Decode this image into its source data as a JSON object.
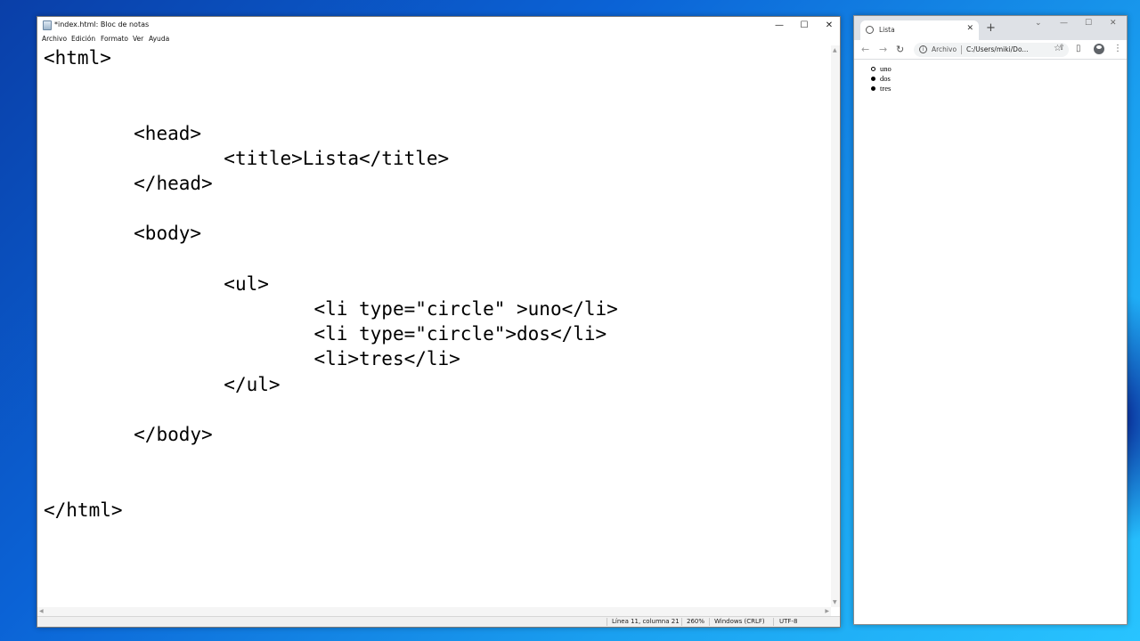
{
  "notepad": {
    "title": "*index.html: Bloc de notas",
    "window_controls": [
      "—",
      "☐",
      "✕"
    ],
    "menu": [
      "Archivo",
      "Edición",
      "Formato",
      "Ver",
      "Ayuda"
    ],
    "code": "<html>\n\n\n\t<head>\n\t\t<title>Lista</title>\n\t</head>\n\n\t<body>\n\n\t\t<ul>\n\t\t\t<li type=\"circle\" >uno</li>\n\t\t\t<li type=\"circle\">dos</li>\n\t\t\t<li>tres</li>\n\t\t</ul>\n\n\t</body>\n\n\n</html>",
    "status": {
      "position": "Línea 11, columna 21",
      "zoom": "260%",
      "line_ending": "Windows (CRLF)",
      "encoding": "UTF-8"
    }
  },
  "browser": {
    "tab_title": "Lista",
    "new_tab": "+",
    "address_label": "Archivo",
    "url": "C:/Users/miki/Do...",
    "list_items": [
      {
        "text": "uno",
        "marker": "circle"
      },
      {
        "text": "dos",
        "marker": "circle"
      },
      {
        "text": "tres",
        "marker": "disc"
      }
    ]
  }
}
